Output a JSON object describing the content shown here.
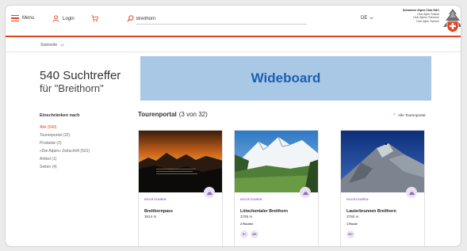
{
  "header": {
    "menu_label": "Menu",
    "login_label": "Login",
    "search_value": "Breithorn",
    "lang_label": "DE",
    "brand_lines": [
      "Schweizer Alpen-Club SAC",
      "Club Alpin Suisse",
      "Club Alpino Svizzero",
      "Club Alpin Svizzer"
    ],
    "accent": "#e2431f"
  },
  "breadcrumb": {
    "label": "Startseite"
  },
  "wideboard": {
    "label": "Wideboard",
    "bg": "#a9c8e6",
    "color": "#1a5fb4"
  },
  "sidebar": {
    "count_title": "540 Suchtreffer",
    "count_sub": "für \"Breithorn\"",
    "filter_head": "Einschränken nach",
    "filters": [
      "Alle (540)",
      "Tourenportal (32)",
      "Produkte (2)",
      "«Die Alpen» Zeitschrift (501)",
      "Artikel (1)",
      "Seiten (4)"
    ]
  },
  "results": {
    "section_title": "Tourenportal",
    "section_count": "(3 von 32)",
    "all_link": "Alle Tourenportal",
    "cards": [
      {
        "category": "HOCHTOUREN",
        "title": "Breithornpass",
        "altitude": "3814 m",
        "routes": "",
        "chips": []
      },
      {
        "category": "HOCHTOUREN",
        "title": "Lötschentaler Breithorn",
        "altitude": "3785 m",
        "routes": "2 Routen",
        "chips": [
          "S+",
          "WS"
        ]
      },
      {
        "category": "HOCHTOUREN",
        "title": "Lauterbrunnen Breithorn",
        "altitude": "3780 m",
        "routes": "1 Route",
        "chips": [
          "ZS+"
        ]
      }
    ]
  }
}
